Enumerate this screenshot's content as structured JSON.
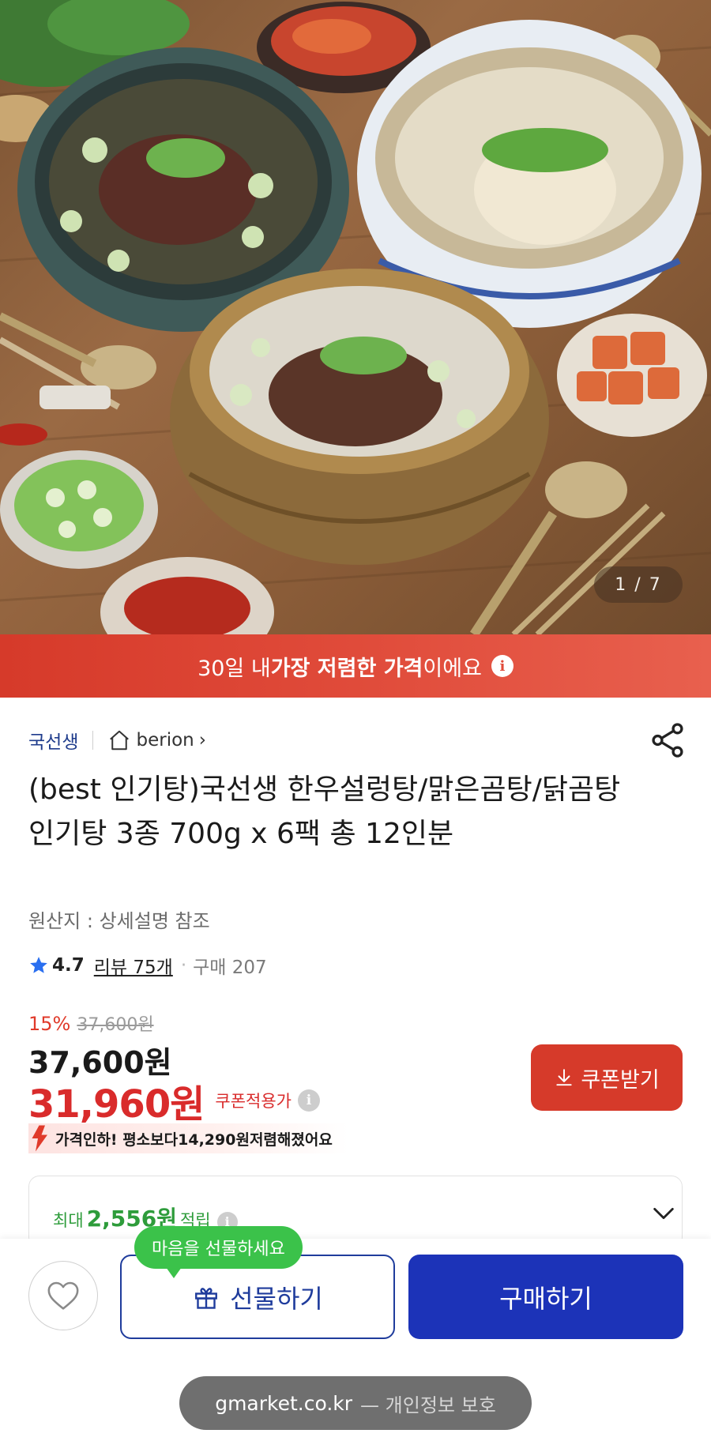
{
  "hero": {
    "image_counter": "1 / 7",
    "description_icon": "food-photo"
  },
  "banner": {
    "text_before": "30일 내 ",
    "text_bold": "가장 저렴한 가격",
    "text_after": "이에요",
    "info_icon": "i"
  },
  "seller": {
    "brand": "국선생",
    "store": "berion",
    "store_chevron": "›"
  },
  "product": {
    "title": "(best 인기탕)국선생 한우설렁탕/맑은곰탕/닭곰탕 인기탕 3종 700g x 6팩 총 12인분",
    "origin": "원산지 : 상세설명 참조",
    "rating": "4.7",
    "reviews": "리뷰 75개",
    "dot": "·",
    "purchases": "구매 207"
  },
  "price": {
    "discount_pct": "15%",
    "original": "37,600원",
    "sale": "37,600원",
    "coupon_price": "31,960원",
    "coupon_label": "쿠폰적용가",
    "info": "i",
    "coupon_button": "쿠폰받기",
    "drop_text_prefix": "가격인하! 평소보다 ",
    "drop_text_amount": "14,290원",
    "drop_text_suffix": " 저렴해졌어요"
  },
  "points": {
    "prefix": "최대",
    "amount": "2,556원",
    "suffix": "적립",
    "info": "i"
  },
  "bottom": {
    "tooltip": "마음을 선물하세요",
    "gift_button": "선물하기",
    "buy_button": "구매하기"
  },
  "urlbar": {
    "domain": "gmarket.co.kr",
    "suffix": "— 개인정보 보호"
  },
  "colors": {
    "banner": "#e04b3a",
    "brand_blue": "#1f3c8c",
    "sale_red": "#d92b2b",
    "buy_blue": "#1c33b8",
    "points_green": "#2e9c3b",
    "tooltip_green": "#3bc24a"
  }
}
